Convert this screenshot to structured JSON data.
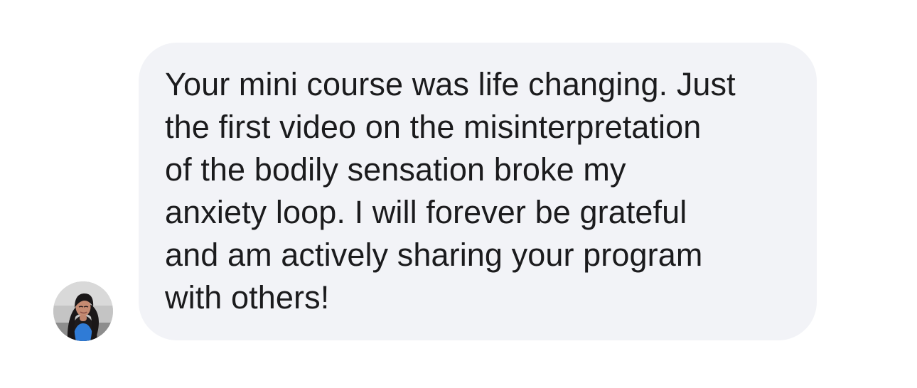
{
  "conversation": {
    "message": {
      "text": "Your mini course was life changing. Just\nthe first video on the misinterpretation\nof the bodily sensation broke my\nanxiety loop. I will forever be grateful\nand am actively sharing your program\nwith others!",
      "sender_avatar_icon": "user-profile-photo"
    }
  },
  "colors": {
    "bubble_background": "#f2f3f7",
    "text": "#1b1b1d",
    "page_background": "#ffffff"
  }
}
